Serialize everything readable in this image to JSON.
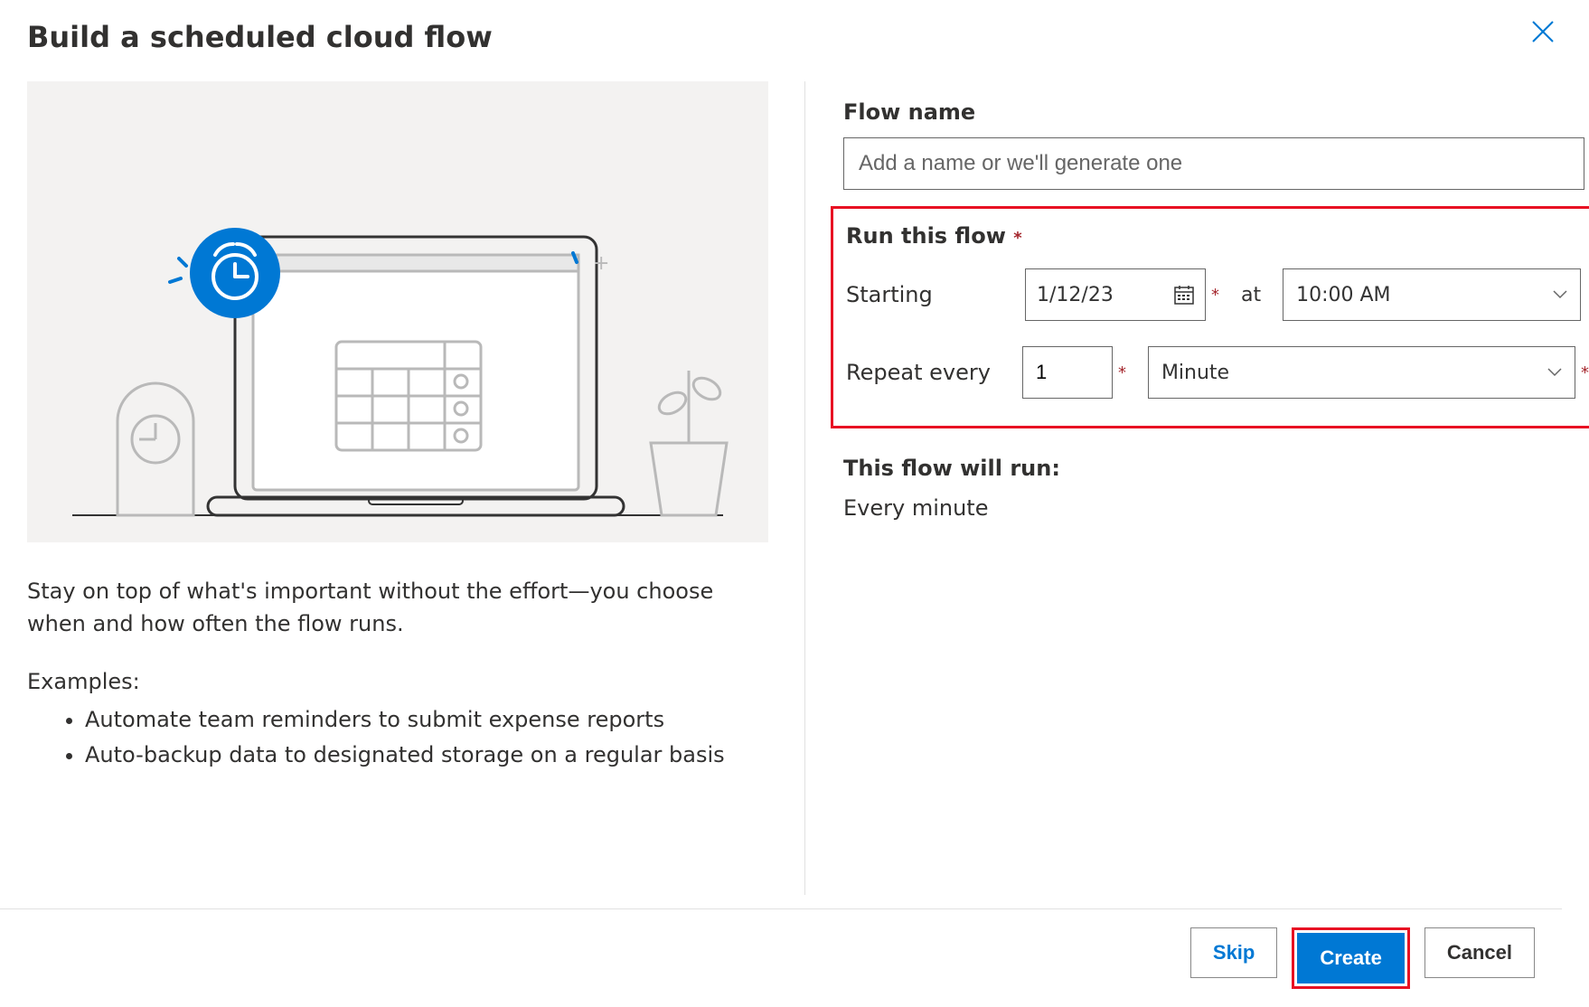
{
  "header": {
    "title": "Build a scheduled cloud flow"
  },
  "left": {
    "description": "Stay on top of what's important without the effort—you choose when and how often the flow runs.",
    "examples_header": "Examples:",
    "examples": [
      "Automate team reminders to submit expense reports",
      "Auto-backup data to designated storage on a regular basis"
    ]
  },
  "form": {
    "flow_name_label": "Flow name",
    "flow_name_placeholder": "Add a name or we'll generate one",
    "flow_name_value": "",
    "run_label": "Run this flow",
    "starting_label": "Starting",
    "date_value": "1/12/23",
    "at_label": "at",
    "time_value": "10:00 AM",
    "repeat_label": "Repeat every",
    "repeat_value": "1",
    "unit_value": "Minute",
    "summary_header": "This flow will run:",
    "summary_text": "Every minute"
  },
  "footer": {
    "skip": "Skip",
    "create": "Create",
    "cancel": "Cancel"
  }
}
